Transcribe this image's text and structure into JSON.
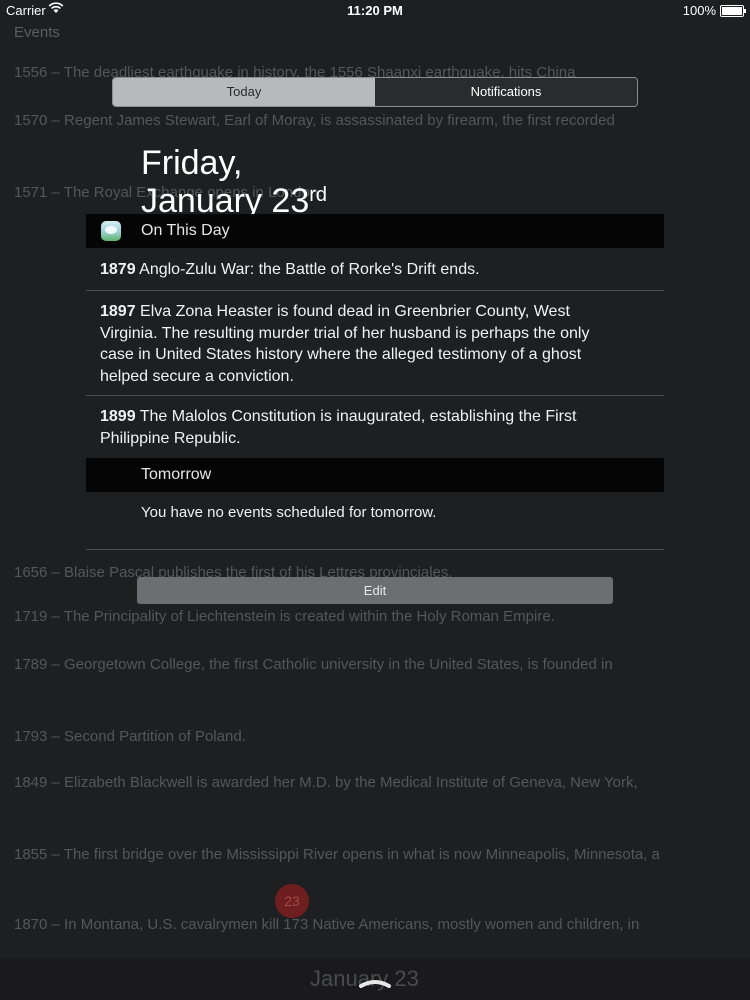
{
  "status_bar": {
    "carrier": "Carrier",
    "time": "11:20 PM",
    "battery": "100%"
  },
  "background": {
    "heading": "Events",
    "badge": "23",
    "bottom_date": "January 23",
    "lines": [
      {
        "text": "1556 – The deadliest earthquake in history, the 1556 Shaanxi earthquake, hits China"
      },
      {
        "text": "1570 – Regent James Stewart, Earl of Moray, is assassinated by firearm, the first recorded"
      },
      {
        "text": "1571 – The Royal Exchange opens in London."
      },
      {
        "text": "1656 – Blaise Pascal publishes the first of his Lettres provinciales."
      },
      {
        "text": "1719 – The Principality of Liechtenstein is created within the Holy Roman Empire."
      },
      {
        "text": "1789 – Georgetown College, the first Catholic university in the United States, is founded in"
      },
      {
        "text": "1793 – Second Partition of Poland."
      },
      {
        "text": "1849 – Elizabeth Blackwell is awarded her M.D. by the Medical Institute of Geneva, New York,"
      },
      {
        "text": "1855 – The first bridge over the Mississippi River opens in what is now Minneapolis, Minnesota, a"
      },
      {
        "text": "1870 – In Montana, U.S. cavalrymen kill 173 Native Americans, mostly women and children, in"
      }
    ]
  },
  "notification_center": {
    "tabs": [
      {
        "label": "Today",
        "active": true
      },
      {
        "label": "Notifications",
        "active": false
      }
    ],
    "date_line1": "Friday,",
    "date_line2": "January 23",
    "date_suffix": "rd",
    "on_this_day": {
      "title": "On This Day",
      "events": [
        {
          "year": "1879",
          "text": "Anglo-Zulu War: the Battle of Rorke's Drift ends."
        },
        {
          "year": "1897",
          "text": "Elva Zona Heaster is found dead in Greenbrier County, West Virginia. The resulting murder trial of her husband is perhaps the only case in United States history where the alleged testimony of a ghost helped secure a conviction."
        },
        {
          "year": "1899",
          "text": "The Malolos Constitution is inaugurated, establishing the First Philippine Republic."
        }
      ]
    },
    "tomorrow": {
      "title": "Tomorrow",
      "message": "You have no events scheduled for tomorrow."
    },
    "edit_label": "Edit"
  },
  "icons": {
    "wifi": "wifi-icon",
    "battery": "battery-icon",
    "app": "on-this-day-app-icon",
    "handle": "chevron-up-handle-icon"
  }
}
